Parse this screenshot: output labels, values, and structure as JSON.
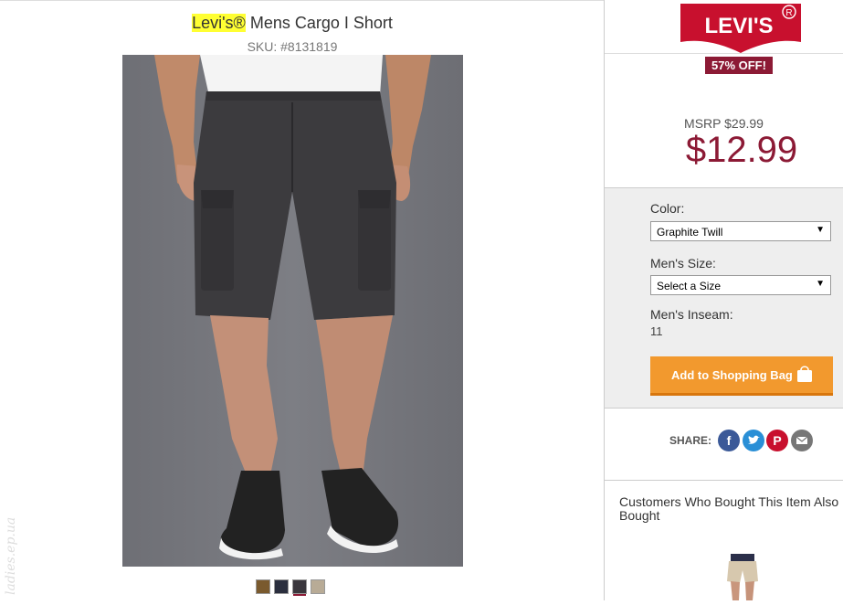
{
  "product": {
    "brand": "Levi's®",
    "name": "Mens Cargo I Short",
    "sku": "SKU: #8131819"
  },
  "swatches": [
    {
      "color": "#7a5a2e",
      "active": false
    },
    {
      "color": "#2a2e3e",
      "active": false
    },
    {
      "color": "#3a373d",
      "active": true
    },
    {
      "color": "#b8ab96",
      "active": false
    }
  ],
  "watermark": "ladies.ep.ua",
  "logo": {
    "text": "LEVI'S",
    "registered": "®"
  },
  "pricing": {
    "discount_badge": "57% OFF!",
    "msrp": "MSRP $29.99",
    "price": "$12.99"
  },
  "options": {
    "color_label": "Color:",
    "color_value": "Graphite Twill",
    "size_label": "Men's Size:",
    "size_value": "Select a Size",
    "inseam_label": "Men's Inseam:",
    "inseam_value": "11",
    "add_to_bag": "Add to Shopping Bag"
  },
  "share": {
    "label": "SHARE:",
    "icons": [
      "facebook-icon",
      "twitter-icon",
      "pinterest-icon",
      "email-icon"
    ]
  },
  "also_bought": {
    "heading": "Customers Who Bought This Item Also Bought"
  },
  "colors": {
    "accent": "#8c1a35",
    "button": "#f2992e",
    "highlight": "#ffff33"
  }
}
